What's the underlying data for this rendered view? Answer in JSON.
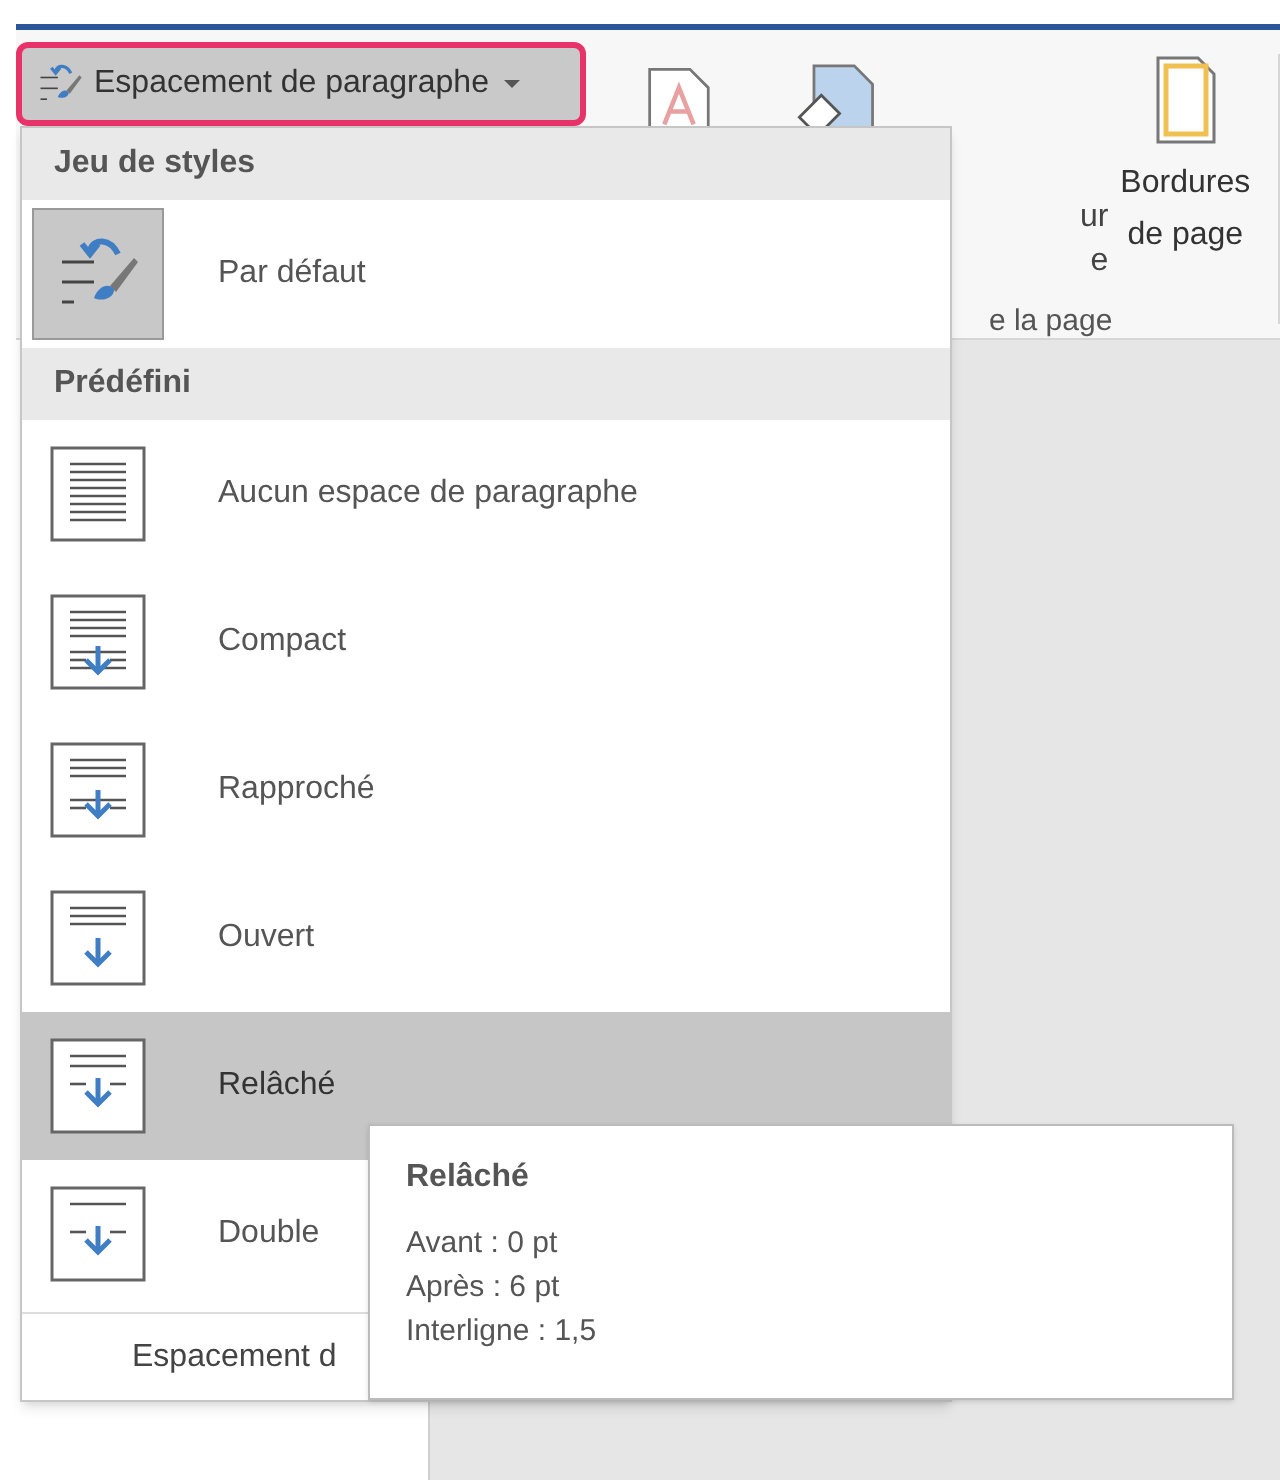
{
  "ribbon": {
    "spacing_button": {
      "label": "Espacement de paragraphe",
      "highlighted": true
    },
    "fragments": [
      "ur",
      "e",
      "e la page"
    ],
    "borders_button": {
      "label": "Bordures de page"
    }
  },
  "menu": {
    "sections": [
      {
        "title": "Jeu de styles",
        "items": [
          {
            "label": "Par défaut",
            "kind": "default",
            "checked": true,
            "selected": false
          }
        ]
      },
      {
        "title": "Prédéfini",
        "items": [
          {
            "label": "Aucun espace de paragraphe",
            "kind": "none",
            "selected": false
          },
          {
            "label": "Compact",
            "kind": "compact",
            "selected": false
          },
          {
            "label": "Rapproché",
            "kind": "tight",
            "selected": false
          },
          {
            "label": "Ouvert",
            "kind": "open",
            "selected": false
          },
          {
            "label": "Relâché",
            "kind": "relaxed",
            "selected": true
          },
          {
            "label": "Double",
            "kind": "double",
            "selected": false
          }
        ]
      }
    ],
    "footer": "Espacement d"
  },
  "tooltip": {
    "title": "Relâché",
    "lines": [
      "Avant : 0 pt",
      "Après : 6 pt",
      "Interligne : 1,5"
    ]
  }
}
